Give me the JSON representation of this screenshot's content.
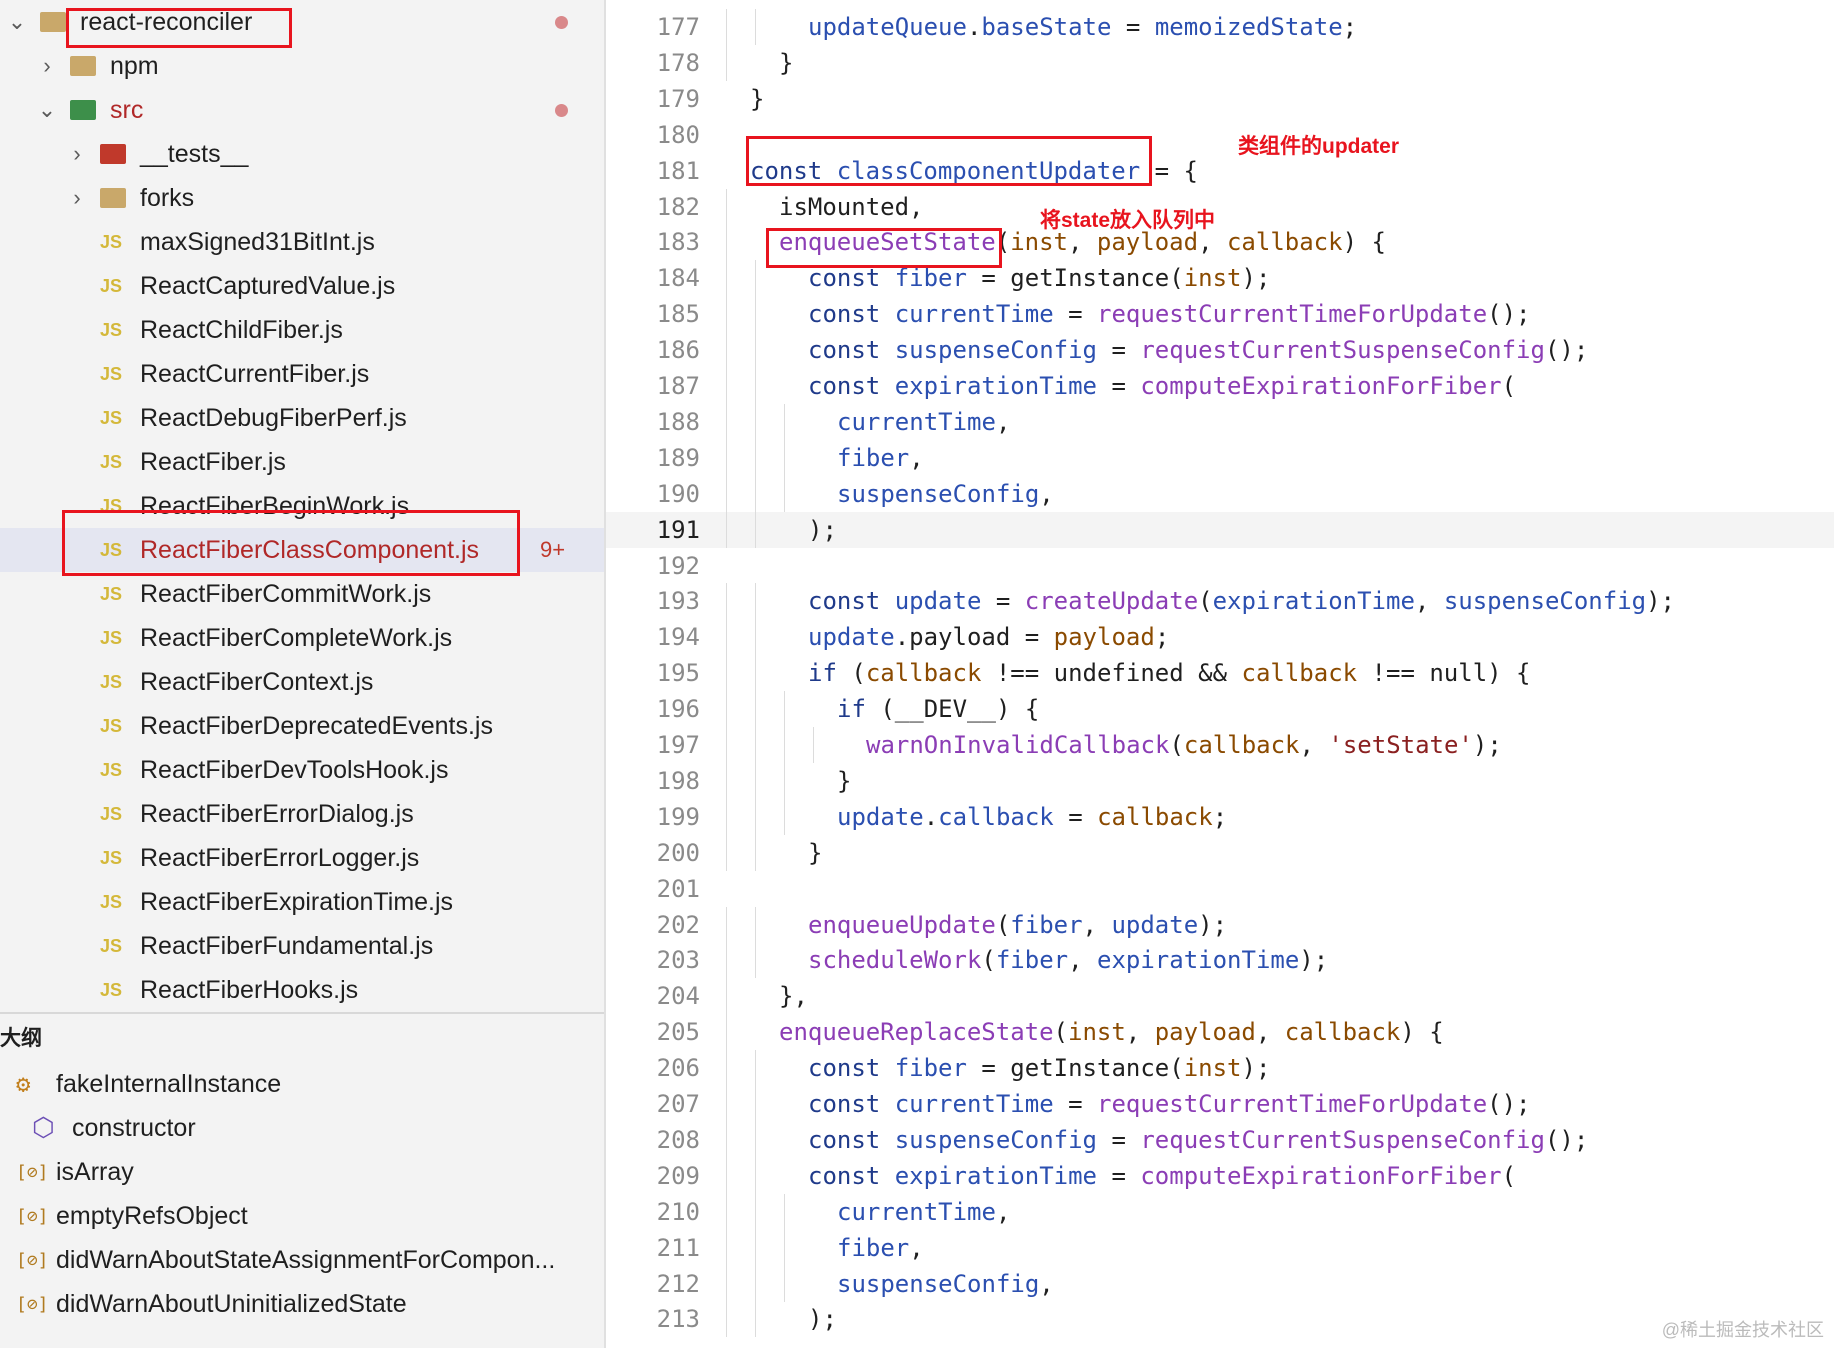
{
  "explorer": {
    "items": [
      {
        "label": "react-reconciler",
        "type": "folder-open",
        "indent": 0,
        "dot": true
      },
      {
        "label": "npm",
        "type": "folder",
        "indent": 1
      },
      {
        "label": "src",
        "type": "folder-src",
        "indent": 1,
        "dot": true
      },
      {
        "label": "__tests__",
        "type": "folder-tests",
        "indent": 2
      },
      {
        "label": "forks",
        "type": "folder",
        "indent": 2
      },
      {
        "label": "maxSigned31BitInt.js",
        "type": "js",
        "indent": 2
      },
      {
        "label": "ReactCapturedValue.js",
        "type": "js",
        "indent": 2
      },
      {
        "label": "ReactChildFiber.js",
        "type": "js",
        "indent": 2
      },
      {
        "label": "ReactCurrentFiber.js",
        "type": "js",
        "indent": 2
      },
      {
        "label": "ReactDebugFiberPerf.js",
        "type": "js",
        "indent": 2
      },
      {
        "label": "ReactFiber.js",
        "type": "js",
        "indent": 2
      },
      {
        "label": "ReactFiberBeginWork.js",
        "type": "js",
        "indent": 2
      },
      {
        "label": "ReactFiberClassComponent.js",
        "type": "js",
        "indent": 2,
        "active": true,
        "badge": "9+"
      },
      {
        "label": "ReactFiberCommitWork.js",
        "type": "js",
        "indent": 2
      },
      {
        "label": "ReactFiberCompleteWork.js",
        "type": "js",
        "indent": 2
      },
      {
        "label": "ReactFiberContext.js",
        "type": "js",
        "indent": 2
      },
      {
        "label": "ReactFiberDeprecatedEvents.js",
        "type": "js",
        "indent": 2
      },
      {
        "label": "ReactFiberDevToolsHook.js",
        "type": "js",
        "indent": 2
      },
      {
        "label": "ReactFiberErrorDialog.js",
        "type": "js",
        "indent": 2
      },
      {
        "label": "ReactFiberErrorLogger.js",
        "type": "js",
        "indent": 2
      },
      {
        "label": "ReactFiberExpirationTime.js",
        "type": "js",
        "indent": 2
      },
      {
        "label": "ReactFiberFundamental.js",
        "type": "js",
        "indent": 2
      },
      {
        "label": "ReactFiberHooks.js",
        "type": "js",
        "indent": 2
      }
    ]
  },
  "outline": {
    "title": "大纲",
    "items": [
      {
        "label": "fakeInternalInstance",
        "icon": "class-icon",
        "indent": 0
      },
      {
        "label": "constructor",
        "icon": "method-icon",
        "indent": 1
      },
      {
        "label": "isArray",
        "icon": "variable-icon",
        "indent": 0
      },
      {
        "label": "emptyRefsObject",
        "icon": "variable-icon",
        "indent": 0
      },
      {
        "label": "didWarnAboutStateAssignmentForCompon...",
        "icon": "variable-icon",
        "indent": 0
      },
      {
        "label": "didWarnAboutUninitializedState",
        "icon": "variable-icon",
        "indent": 0
      }
    ]
  },
  "editor": {
    "current_line": "191",
    "lines": [
      {
        "n": "177",
        "indent": 2,
        "tokens": [
          [
            "v",
            "updateQueue"
          ],
          [
            "",
            "."
          ],
          [
            "v",
            "baseState"
          ],
          [
            "",
            " = "
          ],
          [
            "v",
            "memoizedState"
          ],
          [
            "",
            ";"
          ]
        ]
      },
      {
        "n": "178",
        "indent": 1,
        "tokens": [
          [
            "",
            "}"
          ]
        ]
      },
      {
        "n": "179",
        "indent": 0,
        "tokens": [
          [
            "",
            "}"
          ]
        ]
      },
      {
        "n": "180",
        "indent": 0,
        "tokens": []
      },
      {
        "n": "181",
        "indent": 0,
        "tokens": [
          [
            "k",
            "const "
          ],
          [
            "v",
            "classComponentUpdater"
          ],
          [
            "",
            " = {"
          ]
        ]
      },
      {
        "n": "182",
        "indent": 1,
        "tokens": [
          [
            "",
            "isMounted,"
          ]
        ]
      },
      {
        "n": "183",
        "indent": 1,
        "tokens": [
          [
            "f",
            "enqueueSetState"
          ],
          [
            "",
            "("
          ],
          [
            "p",
            "inst"
          ],
          [
            "",
            ", "
          ],
          [
            "p",
            "payload"
          ],
          [
            "",
            ", "
          ],
          [
            "p",
            "callback"
          ],
          [
            "",
            ") {"
          ]
        ]
      },
      {
        "n": "184",
        "indent": 2,
        "tokens": [
          [
            "k",
            "const "
          ],
          [
            "v",
            "fiber"
          ],
          [
            "",
            " = getInstance("
          ],
          [
            "p",
            "inst"
          ],
          [
            "",
            ");"
          ]
        ]
      },
      {
        "n": "185",
        "indent": 2,
        "tokens": [
          [
            "k",
            "const "
          ],
          [
            "v",
            "currentTime"
          ],
          [
            "",
            " = "
          ],
          [
            "f",
            "requestCurrentTimeForUpdate"
          ],
          [
            "",
            "();"
          ]
        ]
      },
      {
        "n": "186",
        "indent": 2,
        "tokens": [
          [
            "k",
            "const "
          ],
          [
            "v",
            "suspenseConfig"
          ],
          [
            "",
            " = "
          ],
          [
            "f",
            "requestCurrentSuspenseConfig"
          ],
          [
            "",
            "();"
          ]
        ]
      },
      {
        "n": "187",
        "indent": 2,
        "tokens": [
          [
            "k",
            "const "
          ],
          [
            "v",
            "expirationTime"
          ],
          [
            "",
            " = "
          ],
          [
            "f",
            "computeExpirationForFiber"
          ],
          [
            "",
            "("
          ]
        ]
      },
      {
        "n": "188",
        "indent": 3,
        "tokens": [
          [
            "v",
            "currentTime"
          ],
          [
            "",
            ","
          ]
        ]
      },
      {
        "n": "189",
        "indent": 3,
        "tokens": [
          [
            "v",
            "fiber"
          ],
          [
            "",
            ","
          ]
        ]
      },
      {
        "n": "190",
        "indent": 3,
        "tokens": [
          [
            "v",
            "suspenseConfig"
          ],
          [
            "",
            ","
          ]
        ]
      },
      {
        "n": "191",
        "indent": 2,
        "tokens": [
          [
            "",
            ");"
          ]
        ]
      },
      {
        "n": "192",
        "indent": 0,
        "tokens": []
      },
      {
        "n": "193",
        "indent": 2,
        "tokens": [
          [
            "k",
            "const "
          ],
          [
            "v",
            "update"
          ],
          [
            "",
            " = "
          ],
          [
            "f",
            "createUpdate"
          ],
          [
            "",
            "("
          ],
          [
            "v",
            "expirationTime"
          ],
          [
            "",
            ", "
          ],
          [
            "v",
            "suspenseConfig"
          ],
          [
            "",
            ");"
          ]
        ]
      },
      {
        "n": "194",
        "indent": 2,
        "tokens": [
          [
            "v",
            "update"
          ],
          [
            "",
            "."
          ],
          [
            "",
            "payload = "
          ],
          [
            "p",
            "payload"
          ],
          [
            "",
            ";"
          ]
        ]
      },
      {
        "n": "195",
        "indent": 2,
        "tokens": [
          [
            "k",
            "if "
          ],
          [
            "",
            "("
          ],
          [
            "p",
            "callback"
          ],
          [
            "",
            " !== undefined && "
          ],
          [
            "p",
            "callback"
          ],
          [
            "",
            " !== null) {"
          ]
        ]
      },
      {
        "n": "196",
        "indent": 3,
        "tokens": [
          [
            "k",
            "if "
          ],
          [
            "",
            "(__DEV__) {"
          ]
        ]
      },
      {
        "n": "197",
        "indent": 4,
        "tokens": [
          [
            "f",
            "warnOnInvalidCallback"
          ],
          [
            "",
            "("
          ],
          [
            "p",
            "callback"
          ],
          [
            "",
            ", "
          ],
          [
            "s",
            "'setState'"
          ],
          [
            "",
            ");"
          ]
        ]
      },
      {
        "n": "198",
        "indent": 3,
        "tokens": [
          [
            "",
            "}"
          ]
        ]
      },
      {
        "n": "199",
        "indent": 3,
        "tokens": [
          [
            "v",
            "update"
          ],
          [
            "",
            "."
          ],
          [
            "v",
            "callback"
          ],
          [
            "",
            " = "
          ],
          [
            "p",
            "callback"
          ],
          [
            "",
            ";"
          ]
        ]
      },
      {
        "n": "200",
        "indent": 2,
        "tokens": [
          [
            "",
            "}"
          ]
        ]
      },
      {
        "n": "201",
        "indent": 0,
        "tokens": []
      },
      {
        "n": "202",
        "indent": 2,
        "tokens": [
          [
            "f",
            "enqueueUpdate"
          ],
          [
            "",
            "("
          ],
          [
            "v",
            "fiber"
          ],
          [
            "",
            ", "
          ],
          [
            "v",
            "update"
          ],
          [
            "",
            ");"
          ]
        ]
      },
      {
        "n": "203",
        "indent": 2,
        "tokens": [
          [
            "f",
            "scheduleWork"
          ],
          [
            "",
            "("
          ],
          [
            "v",
            "fiber"
          ],
          [
            "",
            ", "
          ],
          [
            "v",
            "expirationTime"
          ],
          [
            "",
            ");"
          ]
        ]
      },
      {
        "n": "204",
        "indent": 1,
        "tokens": [
          [
            "",
            "},"
          ]
        ]
      },
      {
        "n": "205",
        "indent": 1,
        "tokens": [
          [
            "f",
            "enqueueReplaceState"
          ],
          [
            "",
            "("
          ],
          [
            "p",
            "inst"
          ],
          [
            "",
            ", "
          ],
          [
            "p",
            "payload"
          ],
          [
            "",
            ", "
          ],
          [
            "p",
            "callback"
          ],
          [
            "",
            ") {"
          ]
        ]
      },
      {
        "n": "206",
        "indent": 2,
        "tokens": [
          [
            "k",
            "const "
          ],
          [
            "v",
            "fiber"
          ],
          [
            "",
            " = getInstance("
          ],
          [
            "p",
            "inst"
          ],
          [
            "",
            ");"
          ]
        ]
      },
      {
        "n": "207",
        "indent": 2,
        "tokens": [
          [
            "k",
            "const "
          ],
          [
            "v",
            "currentTime"
          ],
          [
            "",
            " = "
          ],
          [
            "f",
            "requestCurrentTimeForUpdate"
          ],
          [
            "",
            "();"
          ]
        ]
      },
      {
        "n": "208",
        "indent": 2,
        "tokens": [
          [
            "k",
            "const "
          ],
          [
            "v",
            "suspenseConfig"
          ],
          [
            "",
            " = "
          ],
          [
            "f",
            "requestCurrentSuspenseConfig"
          ],
          [
            "",
            "();"
          ]
        ]
      },
      {
        "n": "209",
        "indent": 2,
        "tokens": [
          [
            "k",
            "const "
          ],
          [
            "v",
            "expirationTime"
          ],
          [
            "",
            " = "
          ],
          [
            "f",
            "computeExpirationForFiber"
          ],
          [
            "",
            "("
          ]
        ]
      },
      {
        "n": "210",
        "indent": 3,
        "tokens": [
          [
            "v",
            "currentTime"
          ],
          [
            "",
            ","
          ]
        ]
      },
      {
        "n": "211",
        "indent": 3,
        "tokens": [
          [
            "v",
            "fiber"
          ],
          [
            "",
            ","
          ]
        ]
      },
      {
        "n": "212",
        "indent": 3,
        "tokens": [
          [
            "v",
            "suspenseConfig"
          ],
          [
            "",
            ","
          ]
        ]
      },
      {
        "n": "213",
        "indent": 2,
        "tokens": [
          [
            "",
            ");"
          ]
        ]
      }
    ]
  },
  "annotations": {
    "class_updater": "类组件的updater",
    "enqueue_state": "将state放入队列中"
  },
  "watermark": "@稀土掘金技术社区",
  "colors": {
    "highlight_box": "#e8141e",
    "keyword": "#1f3a8a",
    "variable": "#2b4fb0",
    "function": "#8b3db5",
    "param": "#8a4a00"
  }
}
